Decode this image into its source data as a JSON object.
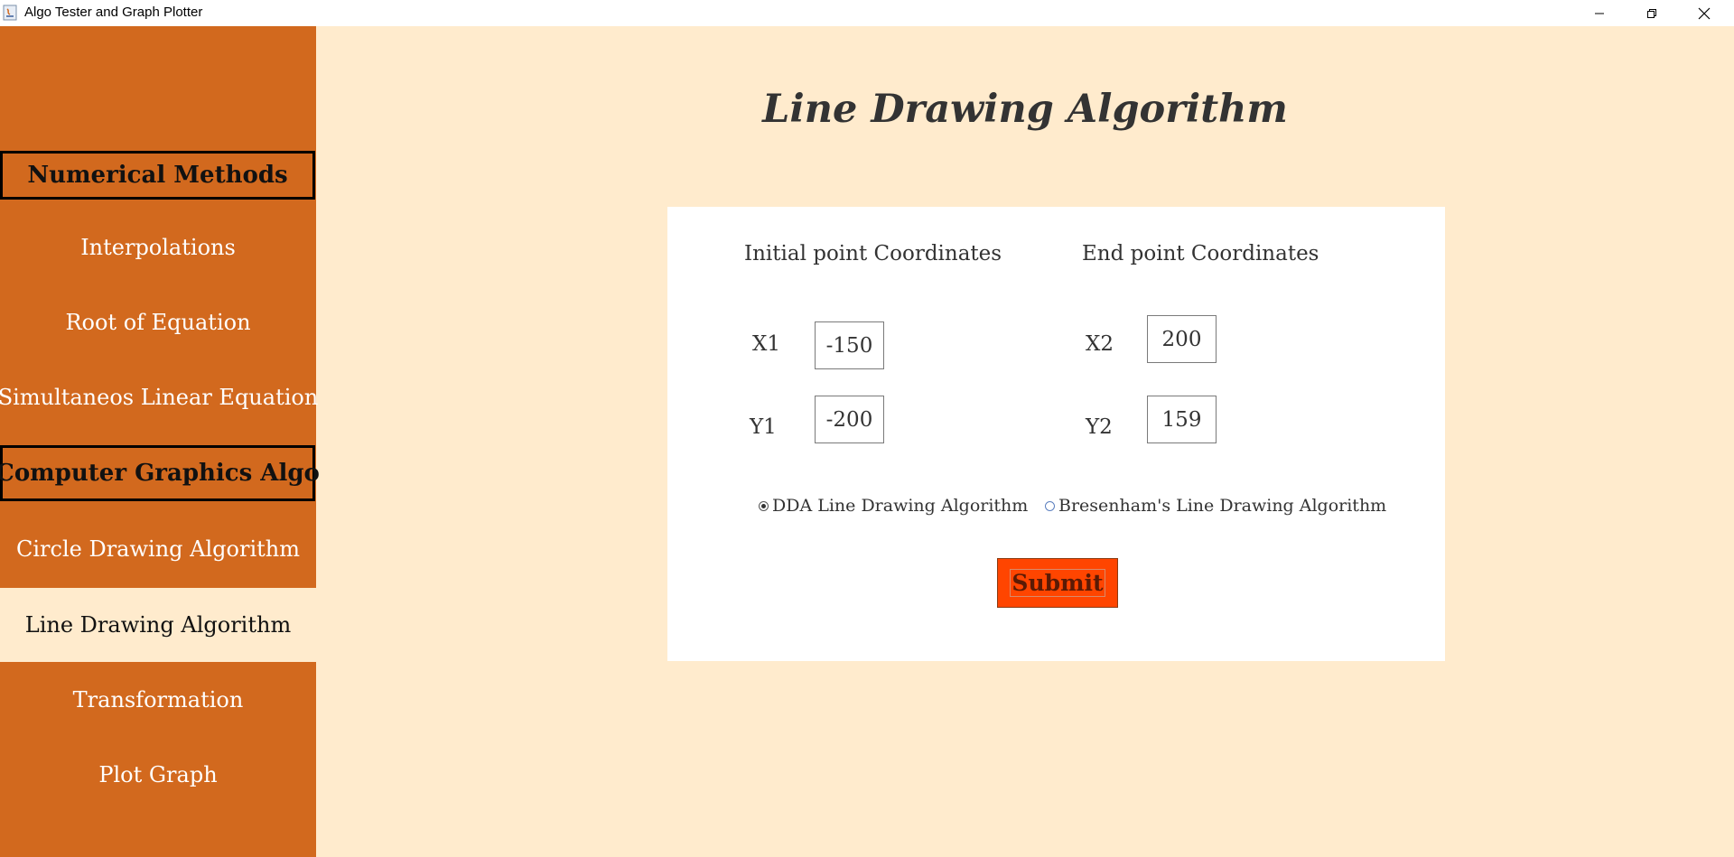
{
  "window": {
    "title": "Algo Tester and Graph Plotter"
  },
  "sidebar": {
    "items": [
      {
        "label": "Numerical Methods",
        "kind": "header"
      },
      {
        "label": "Interpolations",
        "kind": "item"
      },
      {
        "label": "Root of Equation",
        "kind": "item"
      },
      {
        "label": "Simultaneos Linear Equation",
        "kind": "item"
      },
      {
        "label": "Computer Graphics Algo",
        "kind": "header"
      },
      {
        "label": "Circle Drawing Algorithm",
        "kind": "item"
      },
      {
        "label": "Line Drawing Algorithm",
        "kind": "item",
        "active": true
      },
      {
        "label": "Transformation",
        "kind": "item"
      },
      {
        "label": "Plot Graph",
        "kind": "item"
      }
    ]
  },
  "main": {
    "title": "Line Drawing Algorithm",
    "initial_heading": "Initial point Coordinates",
    "end_heading": "End point Coordinates",
    "x1": {
      "label": "X1",
      "value": "-150"
    },
    "y1": {
      "label": "Y1",
      "value": "-200"
    },
    "x2": {
      "label": "X2",
      "value": "200"
    },
    "y2": {
      "label": "Y2",
      "value": "159"
    },
    "options": [
      {
        "label": "DDA Line Drawing Algorithm",
        "selected": true
      },
      {
        "label": "Bresenham's Line Drawing Algorithm",
        "selected": false
      }
    ],
    "submit_label": "Submit"
  },
  "colors": {
    "sidebar": "#d2691e",
    "background": "#ffebcd",
    "submit": "#ff4500"
  }
}
